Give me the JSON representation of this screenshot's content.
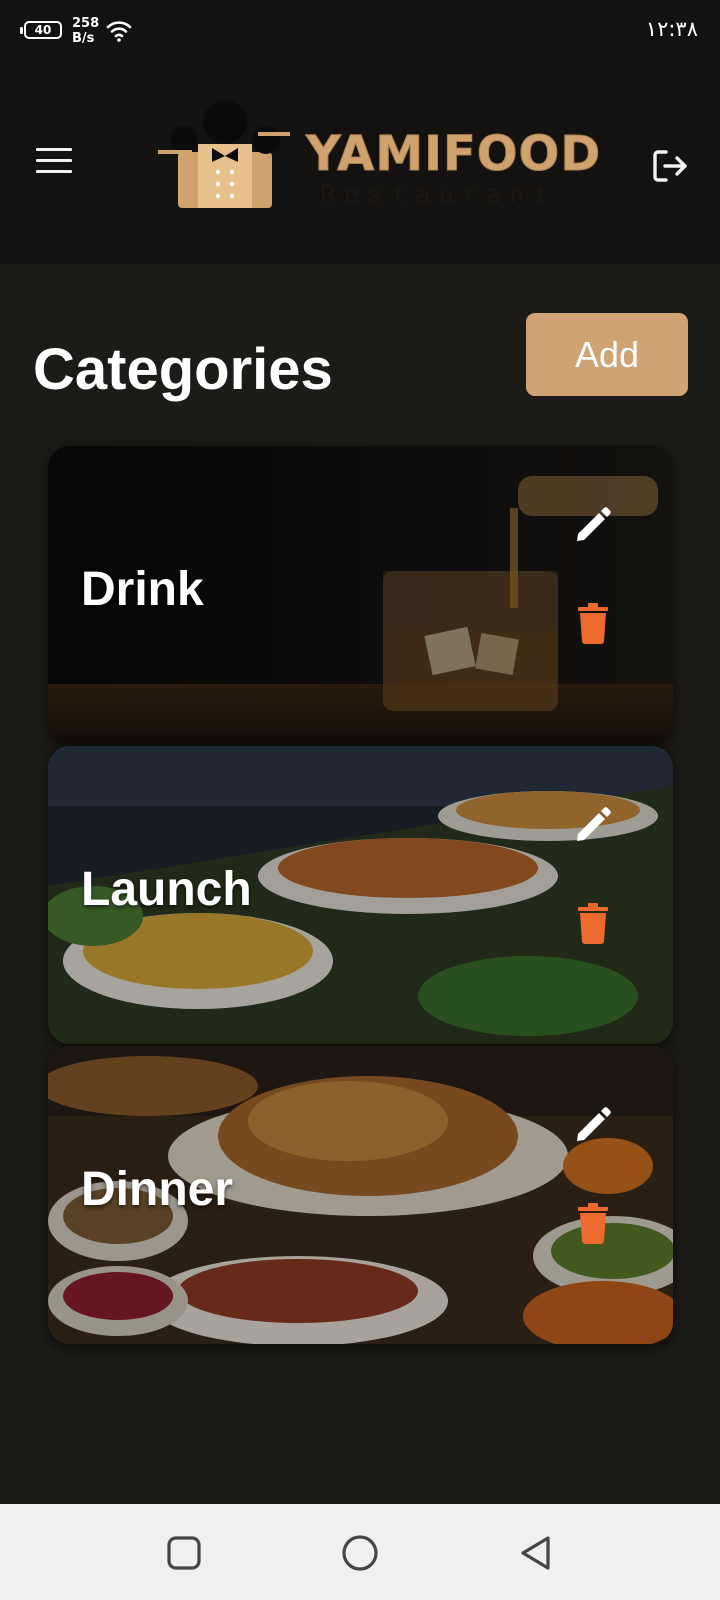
{
  "status_bar": {
    "battery": "40",
    "speed_value": "258",
    "speed_unit": "B/s",
    "time": "۱۲:۳۸"
  },
  "header": {
    "logo_text": "YAMIFOOD",
    "logo_subtext": "Restaurant",
    "menu_icon": "hamburger-icon",
    "logout_icon": "logout-icon"
  },
  "main": {
    "title": "Categories",
    "add_label": "Add",
    "categories": [
      {
        "label": "Drink",
        "edit_icon": "pencil-icon",
        "delete_icon": "trash-icon"
      },
      {
        "label": "Launch",
        "edit_icon": "pencil-icon",
        "delete_icon": "trash-icon"
      },
      {
        "label": "Dinner",
        "edit_icon": "pencil-icon",
        "delete_icon": "trash-icon"
      }
    ]
  },
  "colors": {
    "accent": "#cfa374",
    "delete": "#ec6a2e",
    "background": "#1d1b18",
    "header": "#131211"
  },
  "nav_bar": {
    "icons": [
      "recents-square-icon",
      "home-circle-icon",
      "back-triangle-icon"
    ]
  }
}
